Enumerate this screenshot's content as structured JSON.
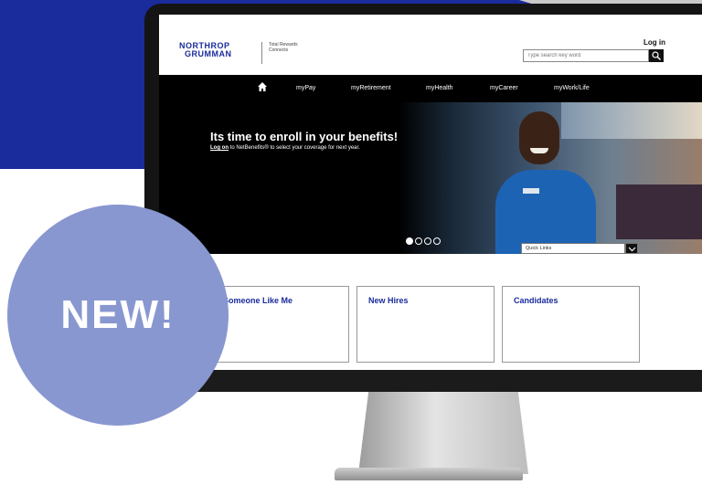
{
  "brand": {
    "logo_line1": "NORTHROP",
    "logo_line2": "GRUMMAN",
    "tagline": "Total Rewards Connects"
  },
  "header": {
    "login_label": "Log in",
    "search_placeholder": "Type search key word"
  },
  "nav": {
    "items": [
      "myPay",
      "myRetirement",
      "myHealth",
      "myCareer",
      "myWork/Life"
    ]
  },
  "hero": {
    "title": "Its time to enroll in your benefits!",
    "subtitle_link": "Log on",
    "subtitle_rest": " to NetBenefits® to select your coverage for next year.",
    "slide_count": 4,
    "active_slide": 1
  },
  "quick_links": {
    "label": "Quick Links"
  },
  "cards": [
    "Someone Like Me",
    "New Hires",
    "Candidates"
  ],
  "badge": {
    "text": "NEW!"
  },
  "colors": {
    "brand_blue": "#1a2b9c",
    "badge": "#8897d0",
    "nav_bg": "#000000"
  }
}
